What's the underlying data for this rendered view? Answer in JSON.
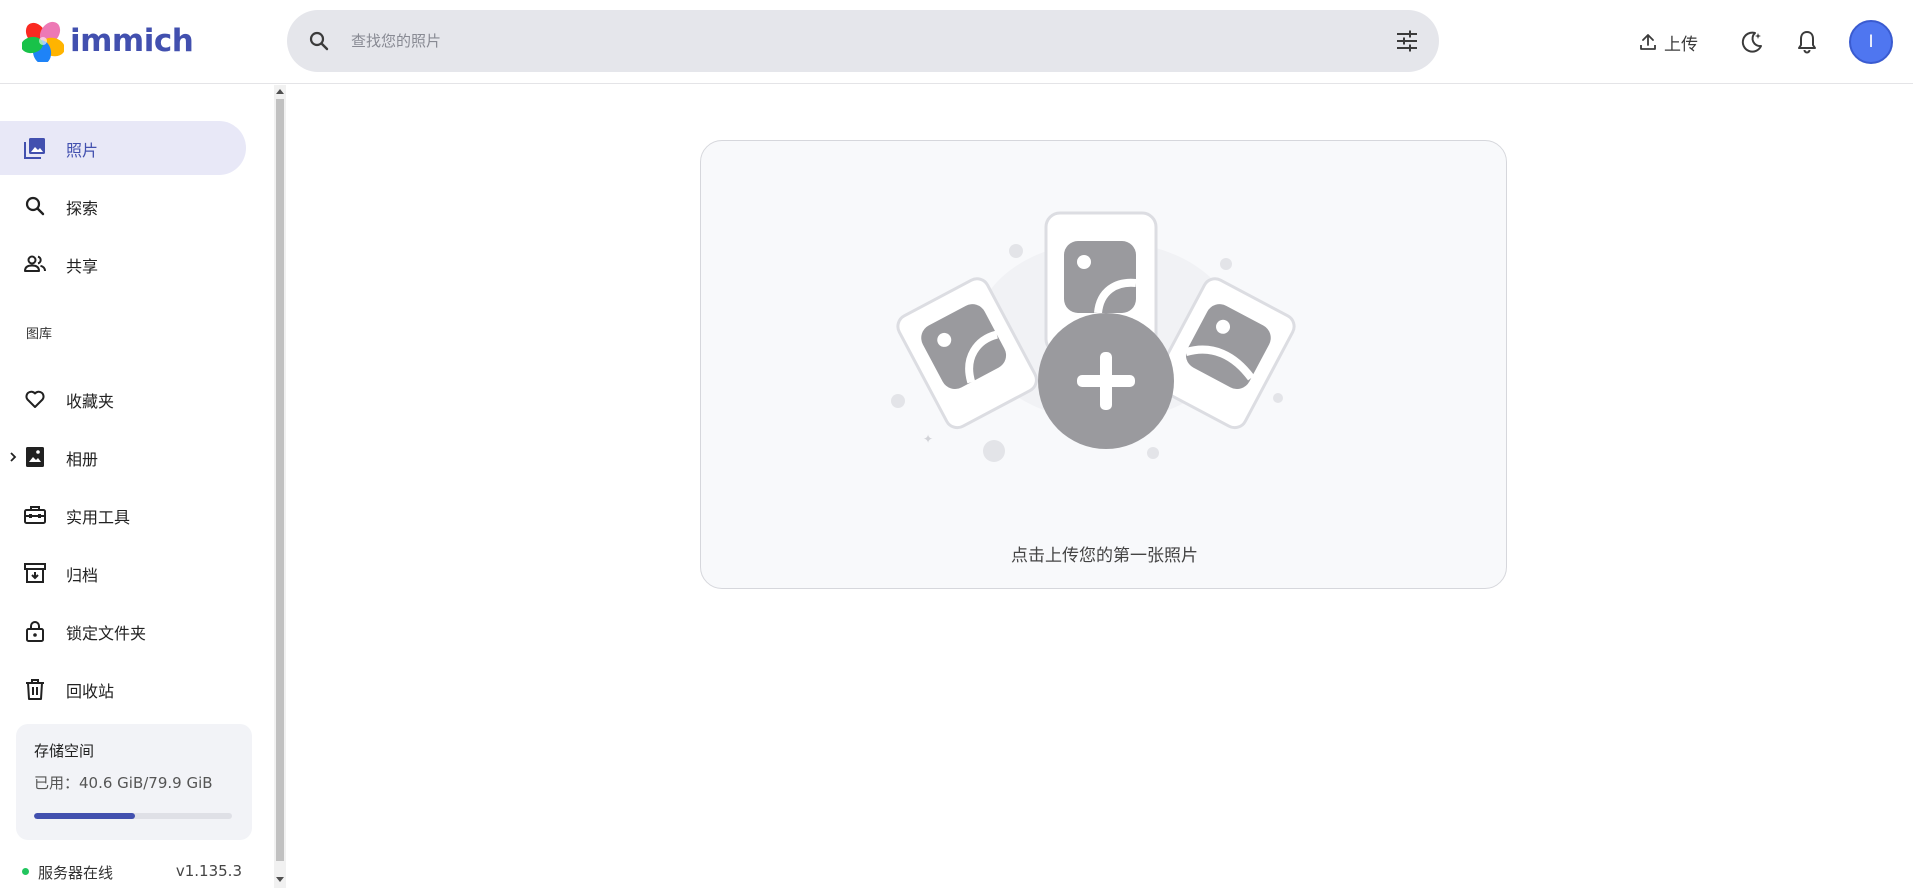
{
  "header": {
    "logo_text": "immich",
    "search": {
      "placeholder": "查找您的照片"
    },
    "upload_label": "上传",
    "avatar_initial": "I"
  },
  "sidebar": {
    "items": [
      {
        "label": "照片",
        "icon": "photos-icon",
        "active": true
      },
      {
        "label": "探索",
        "icon": "search-icon"
      },
      {
        "label": "共享",
        "icon": "people-icon"
      }
    ],
    "library_title": "图库",
    "library_items": [
      {
        "label": "收藏夹",
        "icon": "heart-icon"
      },
      {
        "label": "相册",
        "icon": "album-icon",
        "expandable": true
      },
      {
        "label": "实用工具",
        "icon": "toolbox-icon"
      },
      {
        "label": "归档",
        "icon": "archive-icon"
      },
      {
        "label": "锁定文件夹",
        "icon": "lock-icon"
      },
      {
        "label": "回收站",
        "icon": "trash-icon"
      }
    ],
    "storage": {
      "title": "存储空间",
      "used_text": "已用：40.6 GiB/79.9 GiB",
      "used_fraction": 0.508
    },
    "server": {
      "status": "服务器在线",
      "version": "v1.135.3",
      "status_color": "#22c55e"
    }
  },
  "main": {
    "empty_message": "点击上传您的第一张照片"
  },
  "colors": {
    "accent": "#4250af",
    "avatar": "#4f76f0"
  }
}
